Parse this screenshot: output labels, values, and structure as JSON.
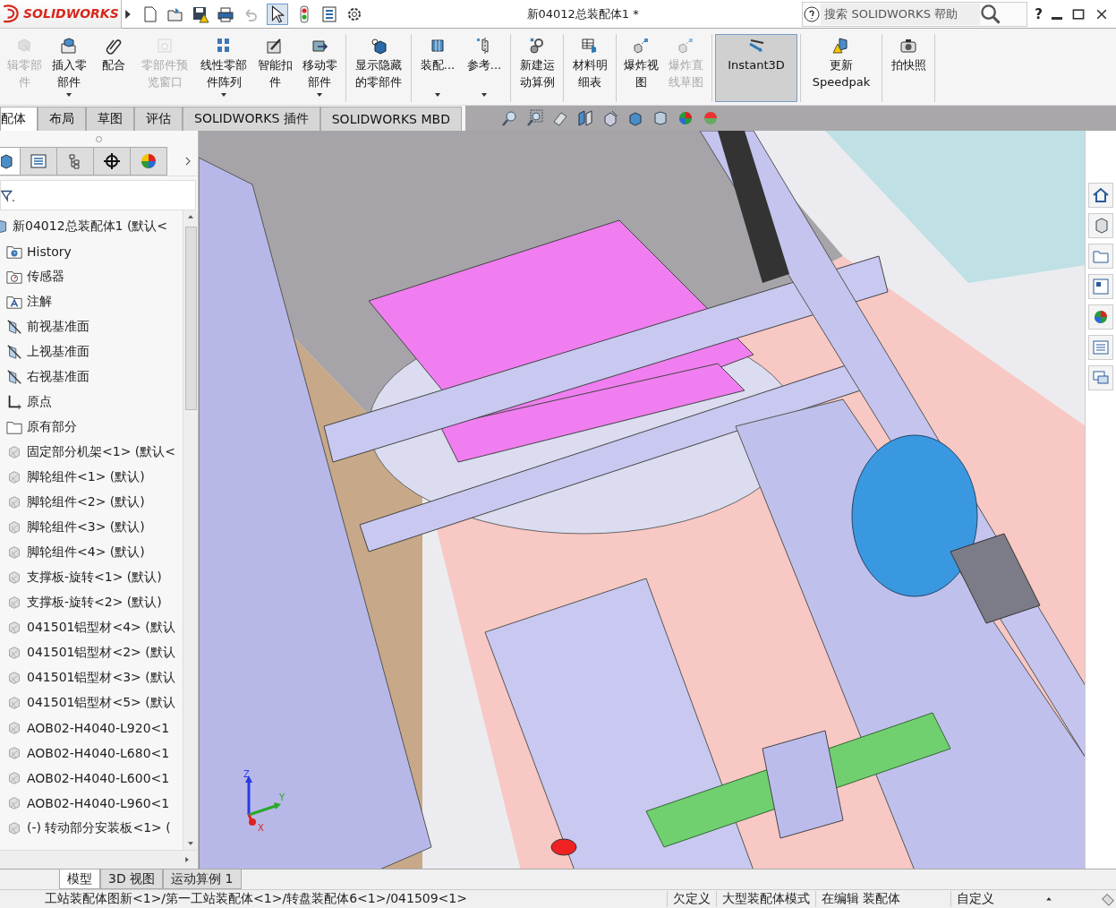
{
  "window": {
    "logo": "SOLIDWORKS",
    "title": "新04012总装配体1 *",
    "help": "?"
  },
  "search": {
    "placeholder": "搜索 SOLIDWORKS 帮助"
  },
  "command_bar": {
    "groups": [
      [
        {
          "label": "辑零部件",
          "kind": "edit",
          "disabled": true,
          "selected": false,
          "dropdown": false
        },
        {
          "label": "插入零部件",
          "kind": "insert",
          "disabled": false,
          "selected": false,
          "dropdown": true
        },
        {
          "label": "配合",
          "kind": "clip",
          "disabled": false,
          "selected": false,
          "dropdown": false
        },
        {
          "label": "零部件预览窗口",
          "kind": "preview",
          "disabled": true,
          "selected": false,
          "dropdown": false
        },
        {
          "label": "线性零部件阵列",
          "kind": "pattern",
          "disabled": false,
          "selected": false,
          "dropdown": true
        },
        {
          "label": "智能扣件",
          "kind": "fastener",
          "disabled": false,
          "selected": false,
          "dropdown": false
        },
        {
          "label": "移动零部件",
          "kind": "move",
          "disabled": false,
          "selected": false,
          "dropdown": true
        }
      ],
      [
        {
          "label": "显示隐藏的零部件",
          "kind": "show",
          "disabled": false,
          "selected": false,
          "dropdown": false
        }
      ],
      [
        {
          "label": "装配...",
          "kind": "assembly",
          "disabled": false,
          "selected": false,
          "dropdown": true
        },
        {
          "label": "参考...",
          "kind": "reference",
          "disabled": false,
          "selected": false,
          "dropdown": true
        }
      ],
      [
        {
          "label": "新建运动算例",
          "kind": "motion",
          "disabled": false,
          "selected": false,
          "dropdown": false
        }
      ],
      [
        {
          "label": "材料明细表",
          "kind": "table",
          "disabled": false,
          "selected": false,
          "dropdown": false
        }
      ],
      [
        {
          "label": "爆炸视图",
          "kind": "explode",
          "disabled": false,
          "selected": false,
          "dropdown": false
        },
        {
          "label": "爆炸直线草图",
          "kind": "explode",
          "disabled": true,
          "selected": false,
          "dropdown": false
        }
      ],
      [
        {
          "label": "Instant3D",
          "kind": "instant3d",
          "disabled": false,
          "selected": true,
          "dropdown": false
        }
      ],
      [
        {
          "label": "更新Speedpak",
          "kind": "speedpak",
          "disabled": false,
          "selected": false,
          "dropdown": false
        }
      ],
      [
        {
          "label": "拍快照",
          "kind": "camera",
          "disabled": false,
          "selected": false,
          "dropdown": false
        }
      ]
    ]
  },
  "tabs": [
    {
      "label": "配体",
      "selected": true
    },
    {
      "label": "布局",
      "selected": false
    },
    {
      "label": "草图",
      "selected": false
    },
    {
      "label": "评估",
      "selected": false
    },
    {
      "label": "SOLIDWORKS 插件",
      "selected": false
    },
    {
      "label": "SOLIDWORKS MBD",
      "selected": false
    }
  ],
  "feature_tree": {
    "label": "新04012总装配体1  (默认<",
    "kind": "assembly",
    "children": [
      {
        "label": "History",
        "kind": "history"
      },
      {
        "label": "传感器",
        "kind": "sensor"
      },
      {
        "label": "注解",
        "kind": "annotation"
      },
      {
        "label": "前视基准面",
        "kind": "plane"
      },
      {
        "label": "上视基准面",
        "kind": "plane"
      },
      {
        "label": "右视基准面",
        "kind": "plane"
      },
      {
        "label": "原点",
        "kind": "origin"
      },
      {
        "label": "原有部分",
        "kind": "folder"
      },
      {
        "label": "固定部分机架<1> (默认<",
        "kind": "part"
      },
      {
        "label": "脚轮组件<1> (默认)",
        "kind": "part"
      },
      {
        "label": "脚轮组件<2> (默认)",
        "kind": "part"
      },
      {
        "label": "脚轮组件<3> (默认)",
        "kind": "part"
      },
      {
        "label": "脚轮组件<4> (默认)",
        "kind": "part"
      },
      {
        "label": "支撑板-旋转<1> (默认)",
        "kind": "part"
      },
      {
        "label": "支撑板-旋转<2> (默认)",
        "kind": "part"
      },
      {
        "label": "041501铝型材<4> (默认",
        "kind": "part"
      },
      {
        "label": "041501铝型材<2> (默认",
        "kind": "part"
      },
      {
        "label": "041501铝型材<3> (默认",
        "kind": "part"
      },
      {
        "label": "041501铝型材<5> (默认",
        "kind": "part"
      },
      {
        "label": "AOB02-H4040-L920<1",
        "kind": "part"
      },
      {
        "label": "AOB02-H4040-L680<1",
        "kind": "part"
      },
      {
        "label": "AOB02-H4040-L600<1",
        "kind": "part"
      },
      {
        "label": "AOB02-H4040-L960<1",
        "kind": "part"
      },
      {
        "label": "(-) 转动部分安装板<1> (",
        "kind": "part"
      }
    ]
  },
  "viewport": {
    "triad": {
      "z": "Z",
      "y": "Y",
      "x": "X"
    }
  },
  "bottom_tabs": [
    {
      "label": "模型",
      "selected": true
    },
    {
      "label": "3D 视图",
      "selected": false
    },
    {
      "label": "运动算例 1",
      "selected": false
    }
  ],
  "status_bar": {
    "path": "工站装配体图新<1>/第一工站装配体<1>/转盘装配体6<1>/041509<1>",
    "items": [
      "欠定义",
      "大型装配体模式",
      "在编辑 装配体"
    ],
    "units": "自定义"
  }
}
